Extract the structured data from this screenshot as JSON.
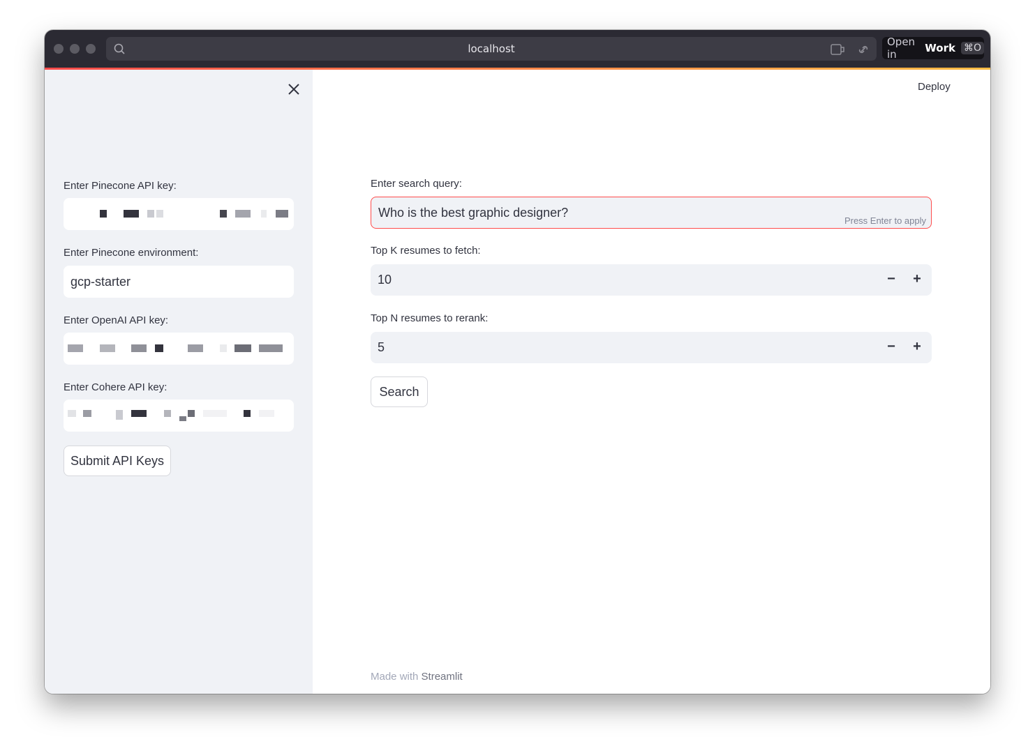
{
  "browser": {
    "url": "localhost",
    "open_in_prefix": "Open in",
    "open_in_target": "Work",
    "open_in_shortcut": "⌘O"
  },
  "sidebar": {
    "pinecone_key_label": "Enter Pinecone API key:",
    "pinecone_env_label": "Enter Pinecone environment:",
    "pinecone_env_value": "gcp-starter",
    "openai_key_label": "Enter OpenAI API key:",
    "cohere_key_label": "Enter Cohere API key:",
    "submit_label": "Submit API Keys"
  },
  "header": {
    "deploy_label": "Deploy"
  },
  "main": {
    "query_label": "Enter search query:",
    "query_value": "Who is the best graphic designer?",
    "query_hint": "Press Enter to apply",
    "topk_label": "Top K resumes to fetch:",
    "topk_value": "10",
    "topn_label": "Top N resumes to rerank:",
    "topn_value": "5",
    "search_label": "Search",
    "minus_glyph": "−",
    "plus_glyph": "+"
  },
  "footer": {
    "prefix": "Made with",
    "brand": "Streamlit"
  },
  "colors": {
    "accent": "#ff4b4b",
    "sidebar_bg": "#f0f2f6",
    "text": "#31333f"
  }
}
